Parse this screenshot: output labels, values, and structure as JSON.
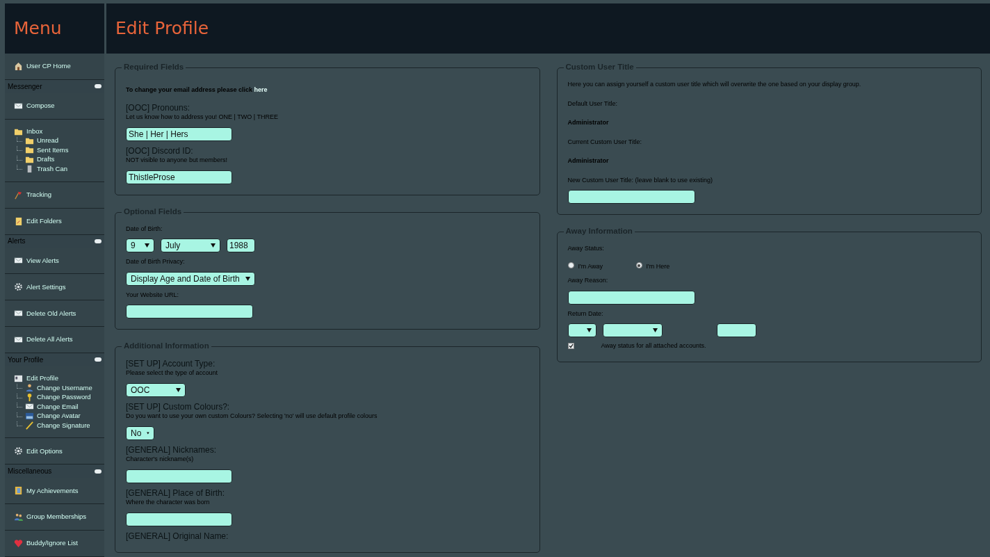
{
  "menu_title": "Menu",
  "page_title": "Edit Profile",
  "sidebar": [
    {
      "kind": "link",
      "label": "User CP Home"
    },
    {
      "kind": "header",
      "label": "Messenger"
    },
    {
      "kind": "link",
      "label": "Compose"
    },
    {
      "kind": "tree",
      "label": "Inbox",
      "children": [
        {
          "label": "Unread"
        },
        {
          "label": "Sent Items"
        },
        {
          "label": "Drafts"
        },
        {
          "label": "Trash Can"
        }
      ]
    },
    {
      "kind": "link",
      "label": "Tracking"
    },
    {
      "kind": "link",
      "label": "Edit Folders"
    },
    {
      "kind": "header",
      "label": "Alerts"
    },
    {
      "kind": "link",
      "label": "View Alerts"
    },
    {
      "kind": "link",
      "label": "Alert Settings"
    },
    {
      "kind": "link",
      "label": "Delete Old Alerts"
    },
    {
      "kind": "link",
      "label": "Delete All Alerts"
    },
    {
      "kind": "header",
      "label": "Your Profile"
    },
    {
      "kind": "tree",
      "label": "Edit Profile",
      "children": [
        {
          "label": "Change Username"
        },
        {
          "label": "Change Password"
        },
        {
          "label": "Change Email"
        },
        {
          "label": "Change Avatar"
        },
        {
          "label": "Change Signature"
        }
      ]
    },
    {
      "kind": "link",
      "label": "Edit Options"
    },
    {
      "kind": "header",
      "label": "Miscellaneous"
    },
    {
      "kind": "link",
      "label": "My Achievements"
    },
    {
      "kind": "link",
      "label": "Group Memberships"
    },
    {
      "kind": "link",
      "label": "Buddy/Ignore List"
    }
  ],
  "columns": [
    [
      {
        "legend": "Required Fields",
        "rows": [
          {
            "kind": "note",
            "text": "To change your email address please click ",
            "link": "here"
          },
          {
            "kind": "label",
            "text": "[OOC] Pronouns:"
          },
          {
            "kind": "hint",
            "text": "Let us know how to address you! ONE | TWO | THREE"
          },
          {
            "kind": "input",
            "value": "She | Her | Hers"
          },
          {
            "kind": "label",
            "text": "[OOC] Discord ID:"
          },
          {
            "kind": "hint",
            "text": "NOT visible to anyone but members!"
          },
          {
            "kind": "input",
            "value": "ThistleProse"
          }
        ]
      },
      {
        "legend": "Optional Fields",
        "rows": [
          {
            "kind": "caption",
            "text": "Date of Birth:"
          },
          {
            "kind": "controls",
            "items": [
              {
                "kind": "select",
                "value": "9"
              },
              {
                "kind": "select",
                "value": "July"
              },
              {
                "kind": "input",
                "value": "1988"
              }
            ]
          },
          {
            "kind": "caption",
            "text": "Date of Birth Privacy:"
          },
          {
            "kind": "controls",
            "items": [
              {
                "kind": "select",
                "value": "Display Age and Date of Birth"
              }
            ]
          },
          {
            "kind": "caption",
            "text": "Your Website URL:"
          },
          {
            "kind": "input"
          }
        ]
      },
      {
        "legend": "Additional Information",
        "rows": [
          {
            "kind": "label",
            "text": "[SET UP] Account Type:"
          },
          {
            "kind": "hint",
            "text": "Please select the type of account"
          },
          {
            "kind": "controls",
            "items": [
              {
                "kind": "select",
                "value": "OOC"
              }
            ]
          },
          {
            "kind": "label",
            "text": "[SET UP] Custom Colours?:"
          },
          {
            "kind": "hint",
            "text": "Do you want to use your own custom Colours? Selecting 'no' will use default profile colours"
          },
          {
            "kind": "controls",
            "items": [
              {
                "kind": "select",
                "value": "No"
              }
            ]
          },
          {
            "kind": "label",
            "text": "[GENERAL] Nicknames:"
          },
          {
            "kind": "hint",
            "text": "Character's nickname(s)"
          },
          {
            "kind": "input"
          },
          {
            "kind": "label",
            "text": "[GENERAL] Place of Birth:"
          },
          {
            "kind": "hint",
            "text": "Where the character was born"
          },
          {
            "kind": "input"
          },
          {
            "kind": "label",
            "text": "[GENERAL] Original Name:"
          }
        ]
      }
    ],
    [
      {
        "legend": "Custom User Title",
        "rows": [
          {
            "kind": "caption",
            "text": "Here you can assign yourself a custom user title which will overwrite the one based on your display group."
          },
          {
            "kind": "caption",
            "text": "Default User Title:"
          },
          {
            "kind": "strong",
            "text": "Administrator"
          },
          {
            "kind": "caption",
            "text": "Current Custom User Title:"
          },
          {
            "kind": "strong",
            "text": "Administrator"
          },
          {
            "kind": "caption",
            "text": "New Custom User Title: (leave blank to use existing)"
          },
          {
            "kind": "input"
          }
        ]
      },
      {
        "legend": "Away Information",
        "rows": [
          {
            "kind": "caption",
            "text": "Away Status:"
          },
          {
            "kind": "radios",
            "options": [
              {
                "label": "I'm Away",
                "selected": false
              },
              {
                "label": "I'm Here",
                "selected": true
              }
            ]
          },
          {
            "kind": "caption",
            "text": "Away Reason:"
          },
          {
            "kind": "input"
          },
          {
            "kind": "caption",
            "text": "Return Date:"
          },
          {
            "kind": "controls",
            "items": [
              {
                "kind": "select"
              },
              {
                "kind": "select"
              },
              {
                "kind": "spacer"
              },
              {
                "kind": "input"
              }
            ]
          },
          {
            "kind": "checkbox",
            "label": "Away status for all attached accounts.",
            "checked": true
          }
        ]
      }
    ]
  ]
}
